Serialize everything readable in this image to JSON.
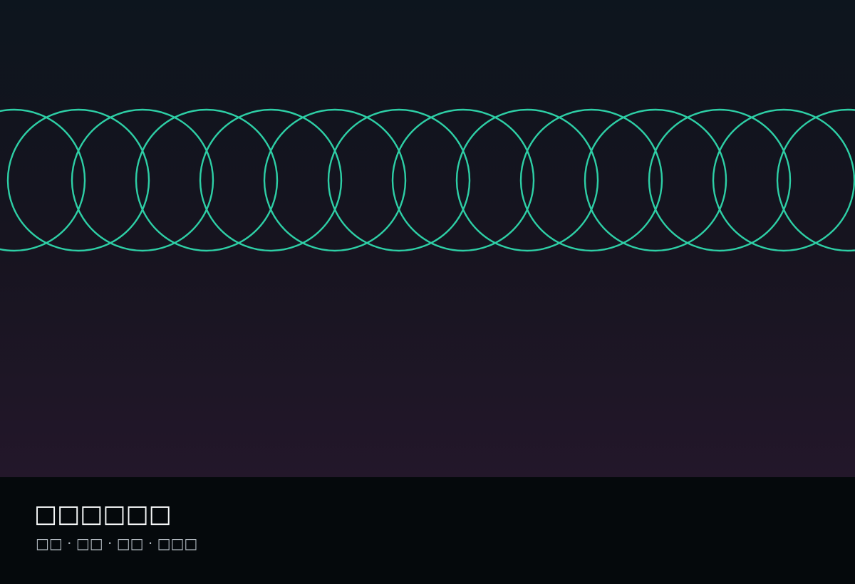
{
  "caption": {
    "title": "□□□□□□",
    "subtitle": "□□ · □□ · □□ · □□□"
  },
  "artwork": {
    "ring_count": 14,
    "colors": {
      "ring_stroke": "#2ecfa6",
      "background_top": "#0d151e",
      "background_bottom": "#23172a",
      "caption_background": "#05090c",
      "title_text": "#f5f7f8",
      "subtitle_text": "#aeb6bd"
    }
  }
}
